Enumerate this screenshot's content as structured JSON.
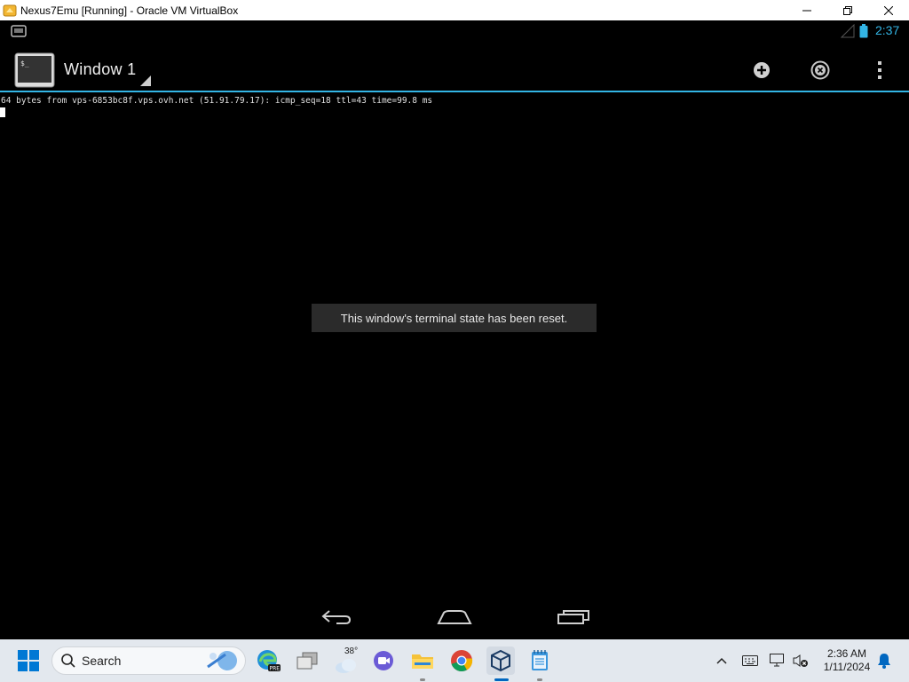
{
  "window": {
    "title": "Nexus7Emu [Running] - Oracle VM VirtualBox",
    "minimize_icon": "minimize-icon",
    "restore_icon": "restore-icon",
    "close_icon": "close-icon"
  },
  "android": {
    "status_bar": {
      "time": "2:37",
      "accent_color": "#33b5e5"
    },
    "action_bar": {
      "window_title": "Window 1",
      "actions": [
        "new-window-icon",
        "close-window-icon",
        "overflow-menu-icon"
      ]
    },
    "terminal": {
      "lines": [
        "64 bytes from vps-6853bc8f.vps.ovh.net (51.91.79.17): icmp_seq=18 ttl=43 time=99.8 ms"
      ]
    },
    "toast": {
      "message": "This window's terminal state has been reset."
    },
    "nav": [
      "back-icon",
      "home-icon",
      "recents-icon"
    ]
  },
  "taskbar": {
    "search_placeholder": "Search",
    "weather_temp": "38°",
    "apps": [
      "edge-icon",
      "task-view-icon",
      "weather-icon",
      "meet-icon",
      "file-explorer-icon",
      "chrome-icon",
      "virtualbox-icon",
      "notepad-icon"
    ],
    "tray": {
      "time": "2:36 AM",
      "date": "1/11/2024"
    }
  }
}
